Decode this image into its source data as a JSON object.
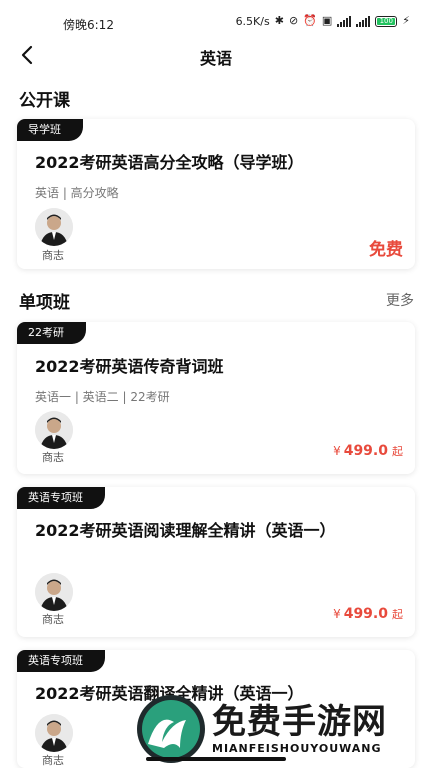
{
  "status_bar": {
    "time": "傍晚6:12",
    "net_speed": "6.5K/s",
    "battery": "100"
  },
  "header": {
    "title": "英语",
    "back_icon": "back-chevron-icon"
  },
  "sections": {
    "open": {
      "title": "公开课"
    },
    "single": {
      "title": "单项班",
      "more": "更多"
    }
  },
  "cards": [
    {
      "tag": "导学班",
      "title": "2022考研英语高分全攻略（导学班）",
      "subtitle": "英语 | 高分攻略",
      "teacher": "商志",
      "free": "免费"
    },
    {
      "tag": "22考研",
      "title": "2022考研英语传奇背词班",
      "subtitle": "英语一 | 英语二 | 22考研",
      "teacher": "商志",
      "price": {
        "symbol": "¥",
        "amount": "499.0",
        "suffix": "起"
      }
    },
    {
      "tag": "英语专项班",
      "title": "2022考研英语阅读理解全精讲（英语一）",
      "teacher": "商志",
      "price": {
        "symbol": "¥",
        "amount": "499.0",
        "suffix": "起"
      }
    },
    {
      "tag": "英语专项班",
      "title": "2022考研英语翻译全精讲（英语一）",
      "teacher": "商志"
    }
  ],
  "watermark": {
    "text": "免费手游网",
    "sub": "MIANFEISHOUYOUWANG"
  },
  "colors": {
    "accent": "#e84a3c",
    "tag_bg": "#111111"
  }
}
